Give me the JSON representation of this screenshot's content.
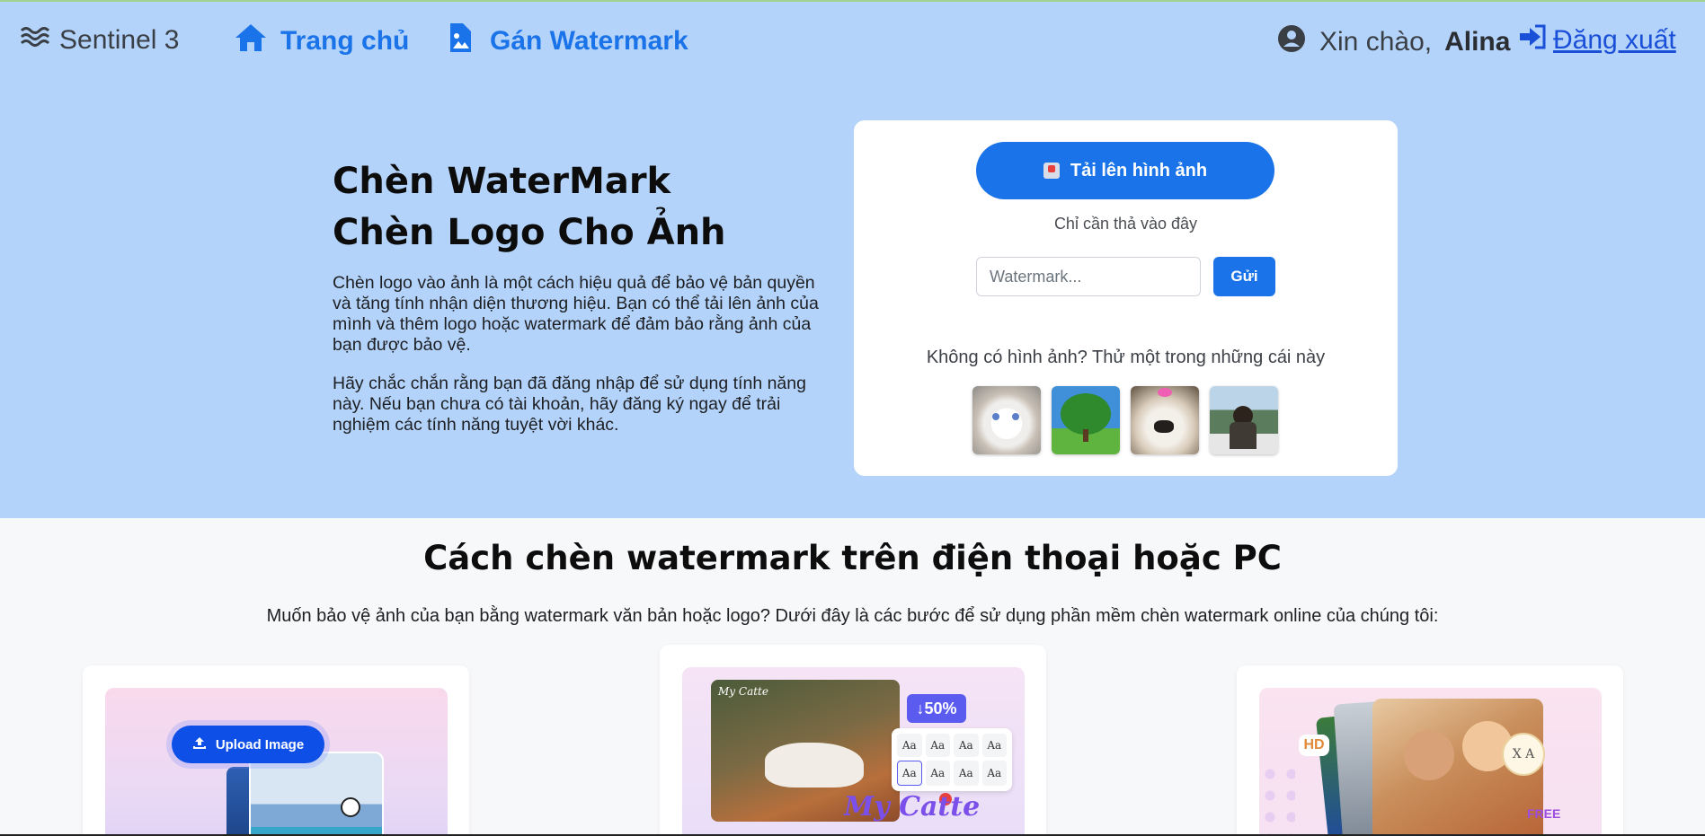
{
  "navbar": {
    "brand": "Sentinel 3",
    "home_label": "Trang chủ",
    "watermark_label": "Gán Watermark",
    "greeting": "Xin chào,",
    "username": "Alina",
    "logout_label": " Đăng xuất"
  },
  "hero": {
    "title_line1": "Chèn WaterMark",
    "title_line2": "Chèn Logo Cho Ảnh",
    "paragraph1": "Chèn logo vào ảnh là một cách hiệu quả để bảo vệ bản quyền và tăng tính nhận diện thương hiệu. Bạn có thể tải lên ảnh của mình và thêm logo hoặc watermark để đảm bảo rằng ảnh của bạn được bảo vệ.",
    "paragraph2": "Hãy chắc chắn rằng bạn đã đăng nhập để sử dụng tính năng này. Nếu bạn chưa có tài khoản, hãy đăng ký ngay để trải nghiệm các tính năng tuyệt vời khác."
  },
  "upload": {
    "button_label": "Tải lên hình ảnh",
    "drop_hint": "Chỉ cần thả vào đây",
    "watermark_placeholder": "Watermark...",
    "watermark_value": "",
    "send_label": "Gửi",
    "try_text": "Không có hình ảnh? Thử một trong những cái này",
    "samples": [
      "cat",
      "tree",
      "dog",
      "girl"
    ]
  },
  "guide": {
    "title": "Cách chèn watermark trên điện thoại hoặc PC",
    "subtitle": "Muốn bảo vệ ảnh của bạn bằng watermark văn bản hoặc logo? Dưới đây là các bước để sử dụng phần mềm chèn watermark online của chúng tôi:",
    "card1": {
      "upload_label": "Upload Image"
    },
    "card2": {
      "photo_watermark": "My Catte",
      "percent": "↓50%",
      "fonts": [
        "Aa",
        "Aa",
        "Aa",
        "Aa",
        "Aa",
        "Aa",
        "Aa",
        "Aa"
      ],
      "overlay_text": "My Catte"
    },
    "card3": {
      "hd_label": "HD",
      "badge_text": "X A",
      "free_label": "FREE"
    }
  },
  "colors": {
    "navbar_bg": "#b4d3fa",
    "accent": "#1a73e8",
    "page_bg": "#f7f8fa"
  }
}
